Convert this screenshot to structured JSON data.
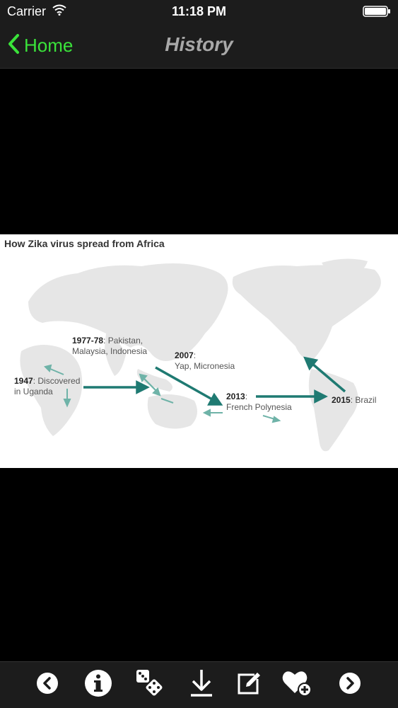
{
  "status_bar": {
    "carrier": "Carrier",
    "time": "11:18 PM"
  },
  "nav": {
    "back_label": "Home",
    "title": "History"
  },
  "figure": {
    "title": "How Zika virus spread from Africa",
    "events": [
      {
        "year": "1947",
        "text": ": Discovered",
        "text2": "in Uganda"
      },
      {
        "year": "1977-78",
        "text": ": Pakistan,",
        "text2": "Malaysia, Indonesia"
      },
      {
        "year": "2007",
        "text": ":",
        "text2": "Yap, Micronesia"
      },
      {
        "year": "2013",
        "text": ":",
        "text2": "French Polynesia"
      },
      {
        "year": "2015",
        "text": ": Brazil",
        "text2": ""
      }
    ]
  },
  "colors": {
    "accent": "#3ae23a",
    "arrow": "#1f7a72",
    "arrow_light": "#6fb3a8",
    "land": "#e6e6e6",
    "bar_bg": "#1c1c1c"
  },
  "toolbar": {
    "icons": [
      "previous-icon",
      "info-icon",
      "dice-icon",
      "download-icon",
      "edit-icon",
      "favorite-add-icon",
      "next-icon"
    ]
  }
}
